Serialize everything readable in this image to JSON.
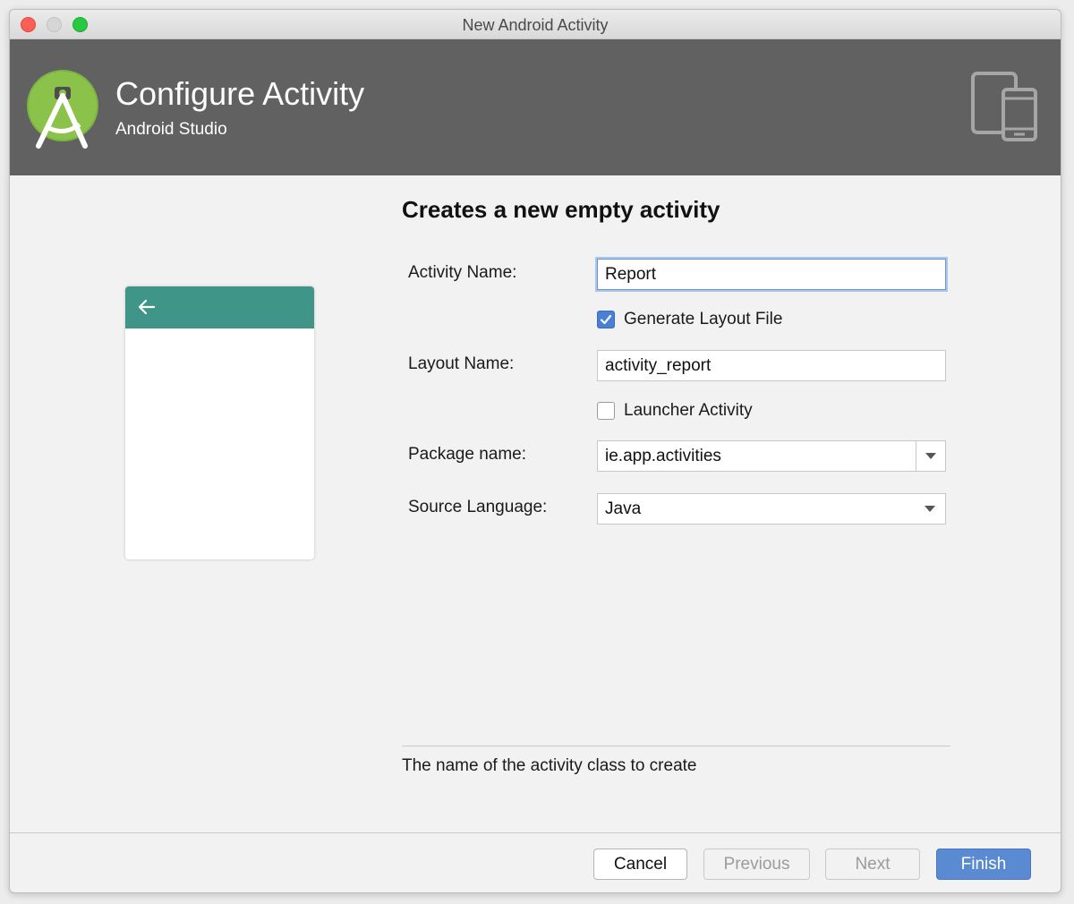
{
  "window": {
    "title": "New Android Activity"
  },
  "header": {
    "title": "Configure Activity",
    "subtitle": "Android Studio"
  },
  "form": {
    "heading": "Creates a new empty activity",
    "activity_name": {
      "label": "Activity Name:",
      "value": "Report"
    },
    "generate_layout": {
      "label": "Generate Layout File",
      "checked": true
    },
    "layout_name": {
      "label": "Layout Name:",
      "value": "activity_report"
    },
    "launcher_activity": {
      "label": "Launcher Activity",
      "checked": false
    },
    "package_name": {
      "label": "Package name:",
      "value": "ie.app.activities"
    },
    "source_language": {
      "label": "Source Language:",
      "value": "Java"
    }
  },
  "help": {
    "text": "The name of the activity class to create"
  },
  "buttons": {
    "cancel": "Cancel",
    "previous": "Previous",
    "next": "Next",
    "finish": "Finish"
  },
  "colors": {
    "header_bg": "#616161",
    "preview_toolbar": "#3f9587",
    "primary_button": "#5a8ad1",
    "android_green": "#8bc34a"
  },
  "icons": {
    "logo": "android-studio-logo-icon",
    "devices": "devices-icon",
    "back": "arrow-back-icon"
  }
}
